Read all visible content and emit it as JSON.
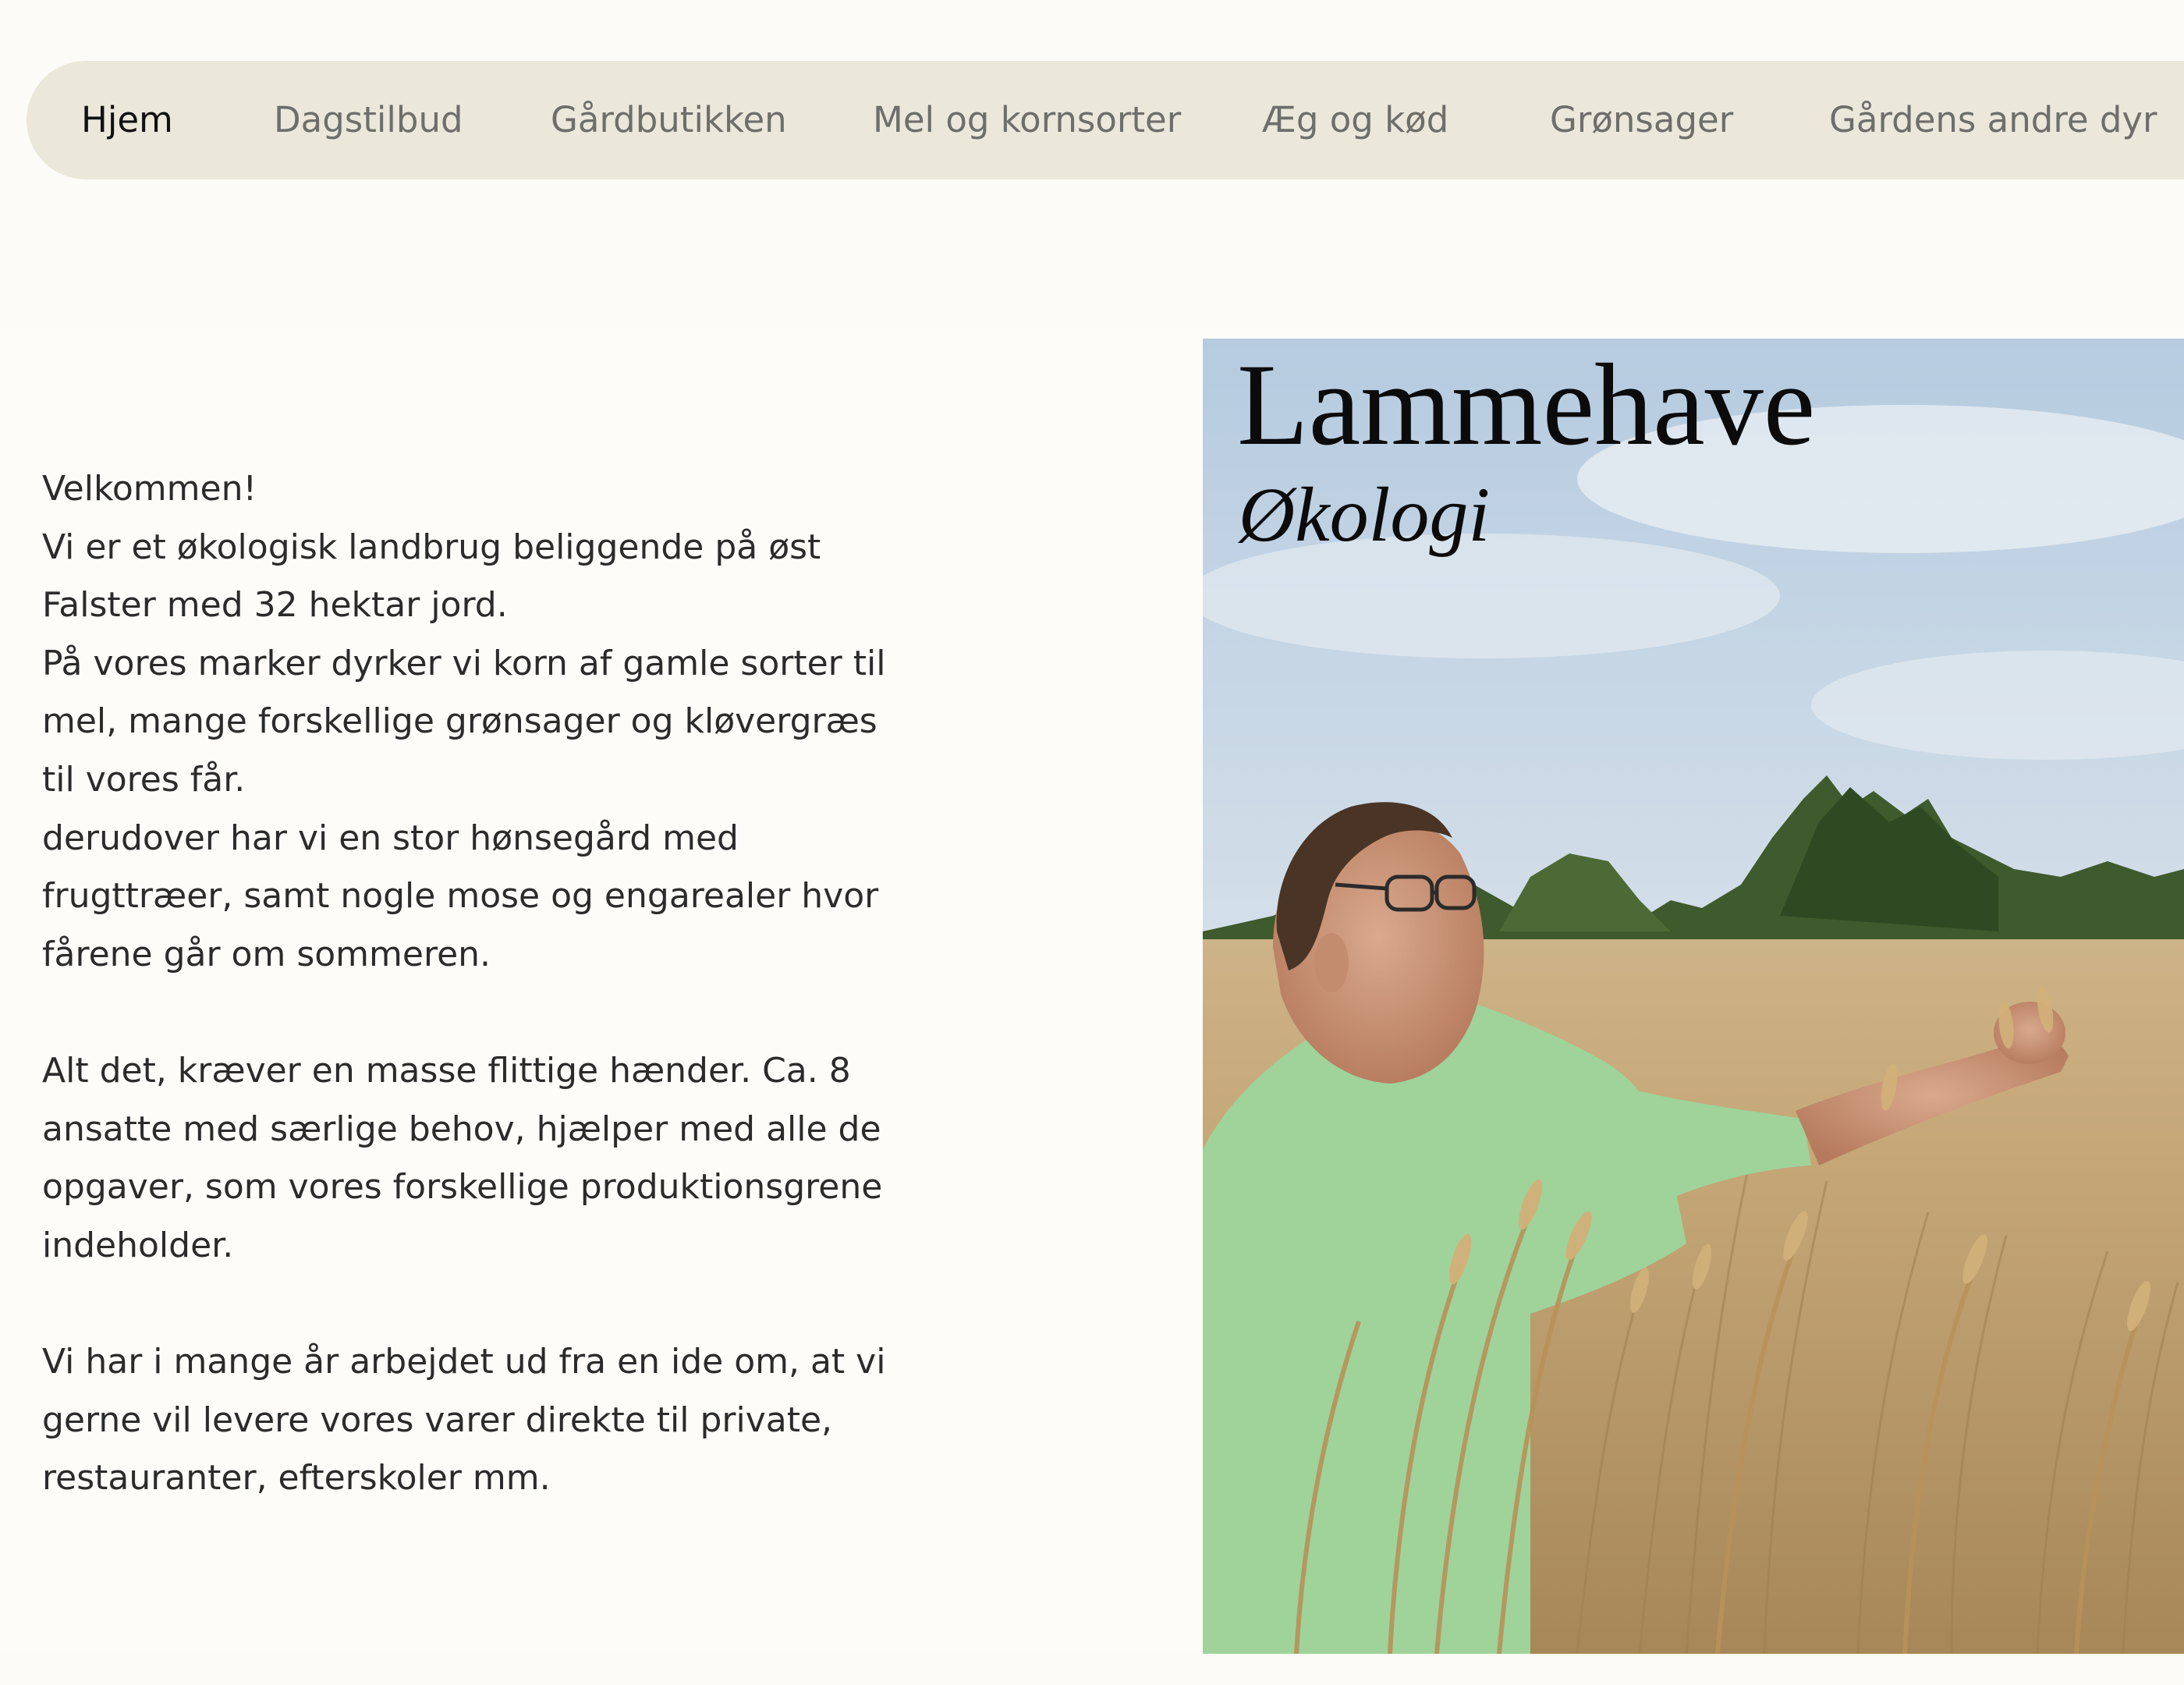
{
  "nav": {
    "items": [
      {
        "label": "Hjem",
        "active": true
      },
      {
        "label": "Dagstilbud"
      },
      {
        "label": "Gårdbutikken"
      },
      {
        "label": "Mel og kornsorter"
      },
      {
        "label": "Æg og kød"
      },
      {
        "label": "Grønsager"
      },
      {
        "label": "Gårdens andre dyr"
      }
    ]
  },
  "intro": {
    "paragraphs": [
      [
        "Velkommen!",
        "Vi er et økologisk landbrug beliggende på øst",
        "Falster med 32 hektar jord.",
        "På vores marker dyrker vi korn af gamle sorter til",
        "mel, mange forskellige grønsager og kløvergræs",
        "til vores får.",
        "derudover har vi en stor hønsegård med",
        "frugttræer, samt nogle mose og engarealer hvor",
        "fårene går om sommeren."
      ],
      [
        "Alt det, kræver en masse flittige hænder. Ca. 8",
        "ansatte med særlige behov, hjælper med alle de",
        "opgaver, som vores forskellige produktionsgrene",
        "indeholder."
      ],
      [
        "Vi har i mange år arbejdet ud fra en ide om, at vi",
        "gerne vil levere vores varer direkte til private,",
        "restauranter, efterskoler mm."
      ]
    ]
  },
  "hero": {
    "title": "Lammehave",
    "subtitle": "Økologi"
  },
  "colors": {
    "page_background": "#fcfbf7",
    "nav_background": "#ebe7da",
    "nav_text": "#6e6e6a",
    "nav_active_text": "#111111",
    "body_text": "#2b2b2b",
    "shirt_green": "#9fd39a",
    "wheat": "#c9a978"
  }
}
